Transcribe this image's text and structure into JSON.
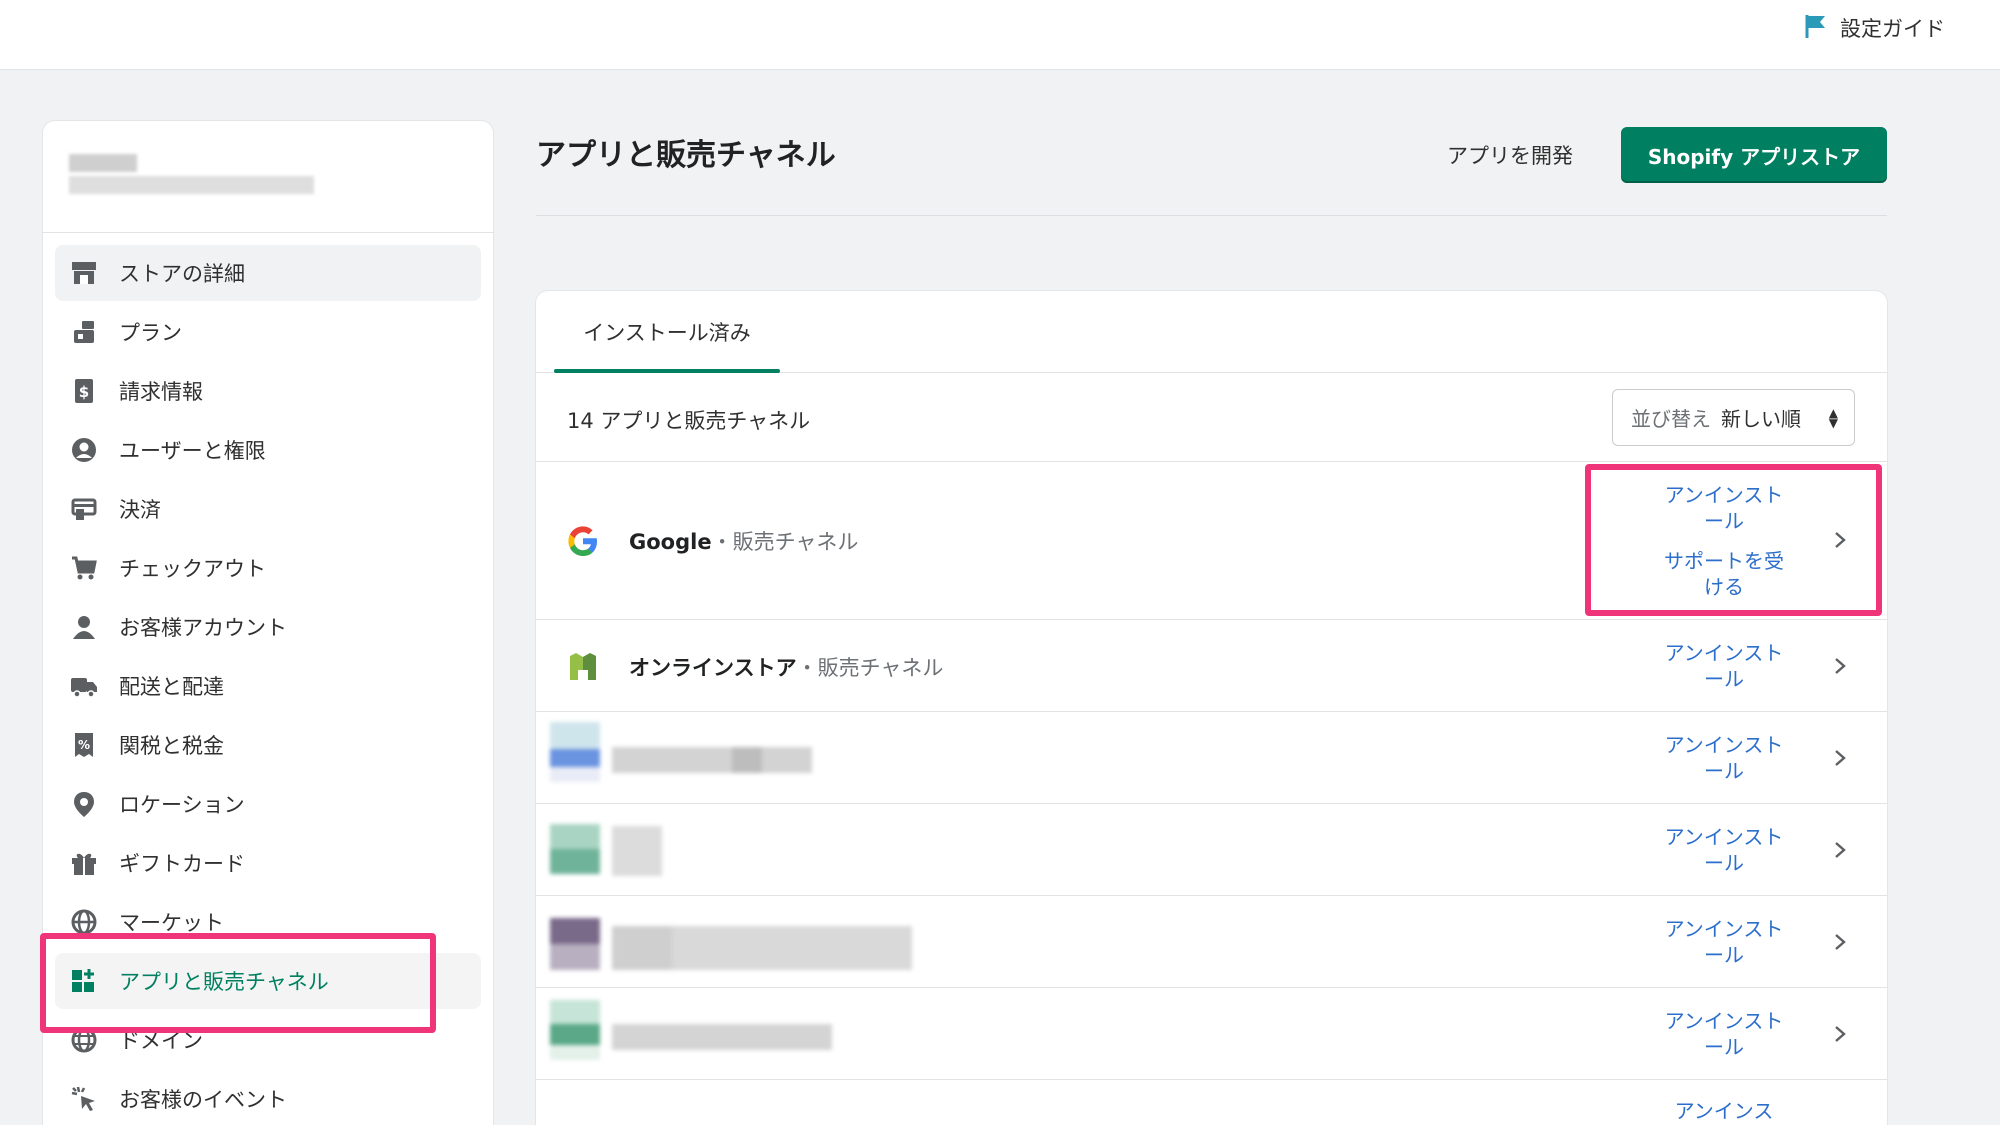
{
  "topbar": {
    "setup_guide": "設定ガイド"
  },
  "sidebar": {
    "items": [
      {
        "label": "ストアの詳細",
        "icon": "store-icon"
      },
      {
        "label": "プラン",
        "icon": "plan-icon"
      },
      {
        "label": "請求情報",
        "icon": "billing-icon"
      },
      {
        "label": "ユーザーと権限",
        "icon": "user-circle-icon"
      },
      {
        "label": "決済",
        "icon": "payments-icon"
      },
      {
        "label": "チェックアウト",
        "icon": "cart-icon"
      },
      {
        "label": "お客様アカウント",
        "icon": "person-icon"
      },
      {
        "label": "配送と配達",
        "icon": "truck-icon"
      },
      {
        "label": "関税と税金",
        "icon": "tax-icon"
      },
      {
        "label": "ロケーション",
        "icon": "location-pin-icon"
      },
      {
        "label": "ギフトカード",
        "icon": "gift-icon"
      },
      {
        "label": "マーケット",
        "icon": "globe-icon"
      },
      {
        "label": "アプリと販売チャネル",
        "icon": "apps-icon"
      },
      {
        "label": "ドメイン",
        "icon": "domain-globe-icon"
      },
      {
        "label": "お客様のイベント",
        "icon": "cursor-click-icon"
      }
    ]
  },
  "main": {
    "title": "アプリと販売チャネル",
    "develop_apps": "アプリを開発",
    "app_store_button": "Shopify アプリストア",
    "tab_installed": "インストール済み",
    "count_text": "14 アプリと販売チャネル",
    "sort": {
      "label": "並び替え",
      "value": "新しい順"
    },
    "apps": [
      {
        "name": "Google",
        "type": "・販売チャネル",
        "uninstall": "アンインストール",
        "support": "サポートを受ける"
      },
      {
        "name": "オンラインストア",
        "type": "・販売チャネル",
        "uninstall": "アンインスト\nール"
      },
      {
        "uninstall": "アンインスト\nール"
      },
      {
        "uninstall": "アンインスト\nール"
      },
      {
        "uninstall": "アンインスト\nール"
      },
      {
        "uninstall": "アンインスト\nール"
      },
      {
        "uninstall": "アンインス"
      }
    ]
  },
  "colors": {
    "accent": "#008060",
    "link": "#2c6ecb",
    "highlight": "#f0347a"
  }
}
